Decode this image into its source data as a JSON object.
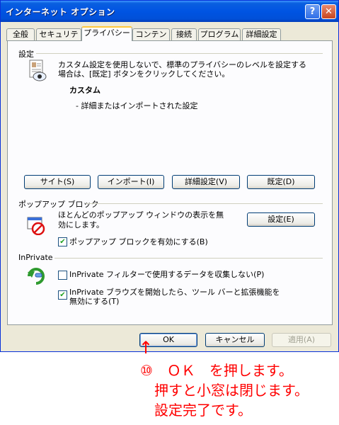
{
  "window": {
    "title": "インターネット オプション",
    "help_glyph": "?",
    "close_glyph": "✕"
  },
  "tabs": [
    {
      "label": "全般"
    },
    {
      "label": "セキュリティ"
    },
    {
      "label": "プライバシー",
      "active": true
    },
    {
      "label": "コンテンツ"
    },
    {
      "label": "接続"
    },
    {
      "label": "プログラム"
    },
    {
      "label": "詳細設定"
    }
  ],
  "settings": {
    "group_label": "設定",
    "description_line1": "カスタム設定を使用しないで、標準のプライバシーのレベルを設定する",
    "description_line2": "場合は、[既定] ボタンをクリックしてください。",
    "level_name": "カスタム",
    "level_detail": "- 詳細またはインポートされた設定",
    "buttons": {
      "sites": "サイト(S)",
      "import": "インポート(I)",
      "advanced": "詳細設定(V)",
      "default": "既定(D)"
    }
  },
  "popup": {
    "group_label": "ポップアップ ブロック",
    "description": "ほとんどのポップアップ ウィンドウの表示を無効にします。",
    "settings_button": "設定(E)",
    "checkbox_label": "ポップアップ ブロックを有効にする(B)",
    "checkbox_checked": true
  },
  "inprivate": {
    "group_label": "InPrivate",
    "filter_label": "InPrivate フィルターで使用するデータを収集しない(P)",
    "filter_checked": false,
    "toolbar_label_line1": "InPrivate ブラウズを開始したら、ツール バーと拡張機能を",
    "toolbar_label_line2": "無効にする(T)",
    "toolbar_checked": true
  },
  "footer": {
    "ok": "OK",
    "cancel": "キャンセル",
    "apply": "適用(A)"
  },
  "annotation": {
    "arrow": "↑",
    "line1": "⑩　ＯＫ　を押します。",
    "line2": "押すと小窓は閉じます。",
    "line3": "設定完了です。",
    "color": "#ff0000"
  }
}
